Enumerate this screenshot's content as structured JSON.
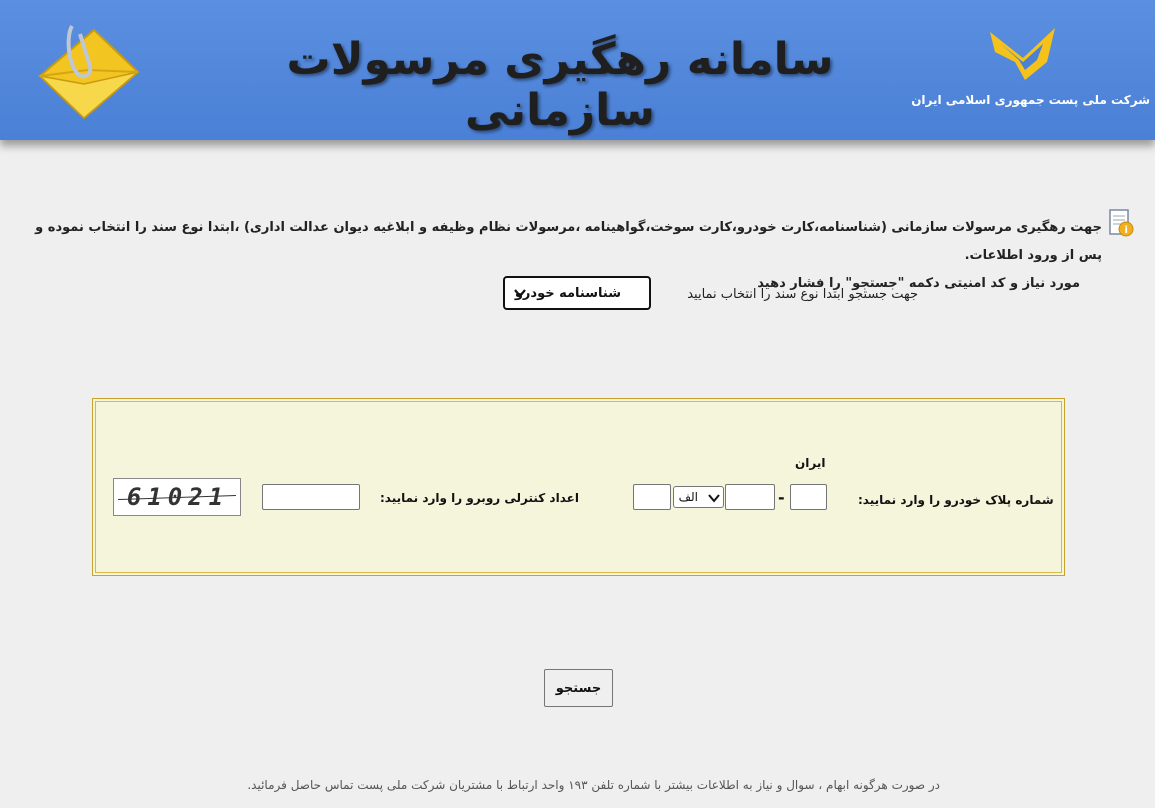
{
  "header": {
    "title": "سامانه رهگیری مرسولات سازمانی",
    "company_name": "شرکت ملی پست جمهوری اسلامی ایران"
  },
  "intro": {
    "line1": "جهت رهگیری مرسولات سازمانی (شناسنامه،کارت خودرو،کارت سوخت،گواهینامه ،مرسولات نظام وظیفه  و ابلاغیه دیوان عدالت اداری) ،ابتدا  نوع سند را انتخاب نموده و پس از ورود اطلاعات.",
    "line2": "مورد نیاز و کد امنیتی دکمه \"جستجو\" را فشار دهید"
  },
  "doc_type": {
    "label": "جهت جستجو ابتدا نوع سند را انتخاب نمایید",
    "selected": "شناسنامه خودرو"
  },
  "form": {
    "plate_label": "شماره پلاک خودرو را وارد نمایید:",
    "iran_label": "ایران",
    "plate_letter": "الف",
    "dash": "-",
    "captcha_label": "اعداد کنترلی روبرو را وارد نمایید:",
    "captcha_value": "61021"
  },
  "search_button": "جستجو",
  "footer": "در صورت هرگونه ابهام ، سوال و نیاز به اطلاعات بیشتر با شماره تلفن ۱۹۳ واحد ارتباط  با مشتریان شرکت ملی پست تماس حاصل فرمائید.",
  "colors": {
    "header_blue": "#4a80d6",
    "form_bg": "#f5f5dc",
    "form_border": "#c9a227"
  }
}
